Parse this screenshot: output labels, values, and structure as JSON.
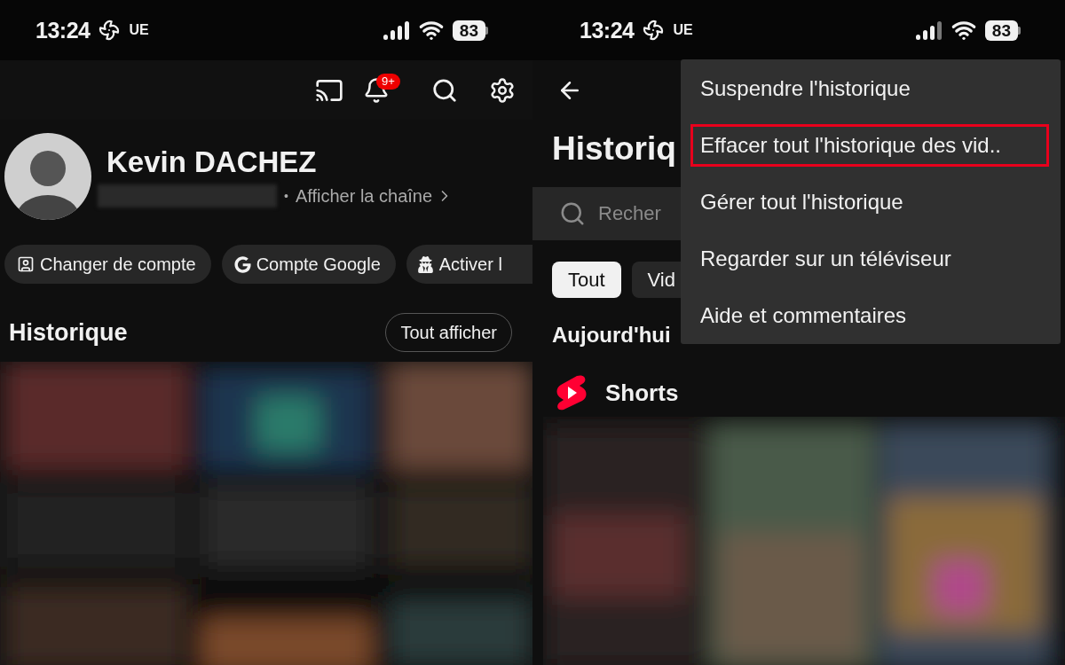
{
  "left_screen": {
    "status_bar": {
      "time": "13:24",
      "carrier": "UE",
      "battery": "83"
    },
    "toolbar": {
      "notification_badge": "9+"
    },
    "profile": {
      "name": "Kevin DACHEZ",
      "separator": "•",
      "channel_link": "Afficher la chaîne"
    },
    "chips": [
      {
        "kind": "account",
        "label": "Changer de compte"
      },
      {
        "kind": "google",
        "label": "Compte Google"
      },
      {
        "kind": "incognito",
        "label": "Activer l"
      }
    ],
    "history": {
      "title": "Historique",
      "button": "Tout afficher"
    }
  },
  "right_screen": {
    "status_bar": {
      "time": "13:24",
      "carrier": "UE",
      "battery": "83"
    },
    "title": "Historiq",
    "search": {
      "placeholder": "Recher"
    },
    "filters": [
      {
        "label": "Tout",
        "selected": true
      },
      {
        "label": "Vid",
        "selected": false
      }
    ],
    "section": "Aujourd'hui",
    "shorts_label": "Shorts",
    "menu": [
      {
        "label": "Suspendre l'historique",
        "highlighted": false
      },
      {
        "label": "Effacer tout l'historique des vid..",
        "highlighted": true
      },
      {
        "label": "Gérer tout l'historique",
        "highlighted": false
      },
      {
        "label": "Regarder sur un téléviseur",
        "highlighted": false
      },
      {
        "label": "Aide et commentaires",
        "highlighted": false
      }
    ]
  }
}
